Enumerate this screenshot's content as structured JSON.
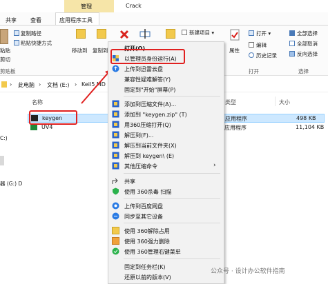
{
  "titlebar": {
    "manage_tab": "管理",
    "window_title": "Crack"
  },
  "ribbon": {
    "tabs": [
      {
        "label": "共享"
      },
      {
        "label": "查看"
      },
      {
        "label": "应用程序工具"
      }
    ],
    "paste_label": "粘贴",
    "cut_label": "剪切",
    "copy_path_label": "复制路径",
    "paste_shortcut_label": "粘贴快捷方式",
    "move_to_label": "移动到",
    "copy_to_label": "复制到",
    "clipboard_group": "剪贴板",
    "new_item_label": "新建项目 ▾",
    "properties_label": "属性",
    "open_label": "打开 ▾",
    "edit_label": "编辑",
    "history_label": "历史记录",
    "open_group": "打开",
    "select_all_label": "全部选择",
    "select_none_label": "全部取消",
    "invert_label": "反向选择",
    "select_group": "选择"
  },
  "address": {
    "items": [
      "此电脑",
      "文档 (E:)",
      "Keil5 MD"
    ]
  },
  "columns": {
    "name": "名称",
    "type": "类型",
    "size": "大小"
  },
  "files": [
    {
      "name": "keygen",
      "type": "应用程序",
      "size": "498 KB"
    },
    {
      "name": "UV4",
      "type": "应用程序",
      "size": "11,104 KB"
    }
  ],
  "nav": {
    "c_drive": "C:)",
    "g_drive": "器 (G:) D"
  },
  "menu": {
    "items": [
      {
        "label": "打开(O)"
      },
      {
        "label": "以管理员身份运行(A)"
      },
      {
        "label": "上传到迅雷云盘"
      },
      {
        "label": "兼容性疑难解答(Y)"
      },
      {
        "label": "固定到\"开始\"屏幕(P)"
      },
      {
        "label": "添加到压缩文件(A)..."
      },
      {
        "label": "添加到 \"keygen.zip\" (T)"
      },
      {
        "label": "用360压缩打开(Q)"
      },
      {
        "label": "解压到(F)..."
      },
      {
        "label": "解压到当前文件夹(X)"
      },
      {
        "label": "解压到 keygen\\ (E)"
      },
      {
        "label": "其他压缩命令"
      },
      {
        "label": "共享"
      },
      {
        "label": "使用 360杀毒 扫描"
      },
      {
        "label": "上传到百度网盘"
      },
      {
        "label": "同步至其它设备"
      },
      {
        "label": "使用 360解除占用"
      },
      {
        "label": "使用 360强力删除"
      },
      {
        "label": "使用 360管理右键菜单"
      },
      {
        "label": "固定到任务栏(K)"
      },
      {
        "label": "还原以前的版本(V)"
      }
    ]
  },
  "watermark": "公众号 · 设计办公软件指南",
  "colors": {
    "accent_red": "#e0201f",
    "selection": "#cde8ff",
    "manage_tab": "#f6e5a8"
  }
}
